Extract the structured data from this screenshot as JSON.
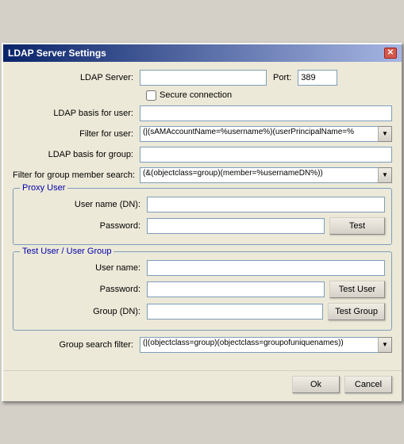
{
  "window": {
    "title": "LDAP Server Settings",
    "close_label": "✕"
  },
  "form": {
    "ldap_server_label": "LDAP Server:",
    "ldap_server_value": "",
    "port_label": "Port:",
    "port_value": "389",
    "secure_label": "Secure connection",
    "ldap_basis_user_label": "LDAP basis for user:",
    "ldap_basis_user_value": "",
    "filter_user_label": "Filter for user:",
    "filter_user_value": "(|(sAMAccountName=%username%)(userPrincipalName=%",
    "ldap_basis_group_label": "LDAP basis for group:",
    "ldap_basis_group_value": "",
    "filter_group_label": "Filter for group member search:",
    "filter_group_value": "(&(objectclass=group)(member=%usernameDN%))",
    "proxy_section_label": "Proxy User",
    "proxy_username_label": "User name (DN):",
    "proxy_username_value": "",
    "proxy_password_label": "Password:",
    "proxy_password_value": "",
    "test_button_label": "Test",
    "test_user_section_label": "Test User / User Group",
    "test_username_label": "User name:",
    "test_username_value": "",
    "test_password_label": "Password:",
    "test_password_value": "",
    "test_user_button_label": "Test User",
    "test_group_label": "Group (DN):",
    "test_group_value": "",
    "test_group_button_label": "Test Group",
    "group_search_label": "Group search filter:",
    "group_search_value": "(|(objectclass=group)(objectclass=groupofuniquenames))",
    "ok_button_label": "Ok",
    "cancel_button_label": "Cancel"
  }
}
